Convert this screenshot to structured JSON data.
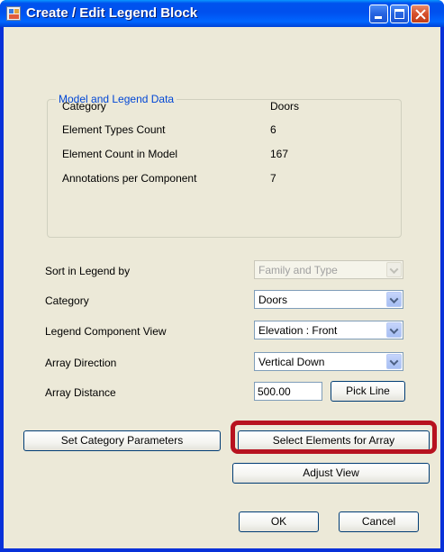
{
  "window": {
    "title": "Create / Edit Legend Block"
  },
  "group": {
    "title": "Model and Legend Data",
    "rows": [
      {
        "label": "Category",
        "value": "Doors"
      },
      {
        "label": "Element Types Count",
        "value": "6"
      },
      {
        "label": "Element Count in Model",
        "value": "167"
      },
      {
        "label": "Annotations per Component",
        "value": "7"
      }
    ]
  },
  "form": {
    "sort_label": "Sort in Legend by",
    "sort_value": "Family and Type",
    "category_label": "Category",
    "category_value": "Doors",
    "view_label": "Legend Component View",
    "view_value": "Elevation : Front",
    "direction_label": "Array Direction",
    "direction_value": "Vertical Down",
    "distance_label": "Array Distance",
    "distance_value": "500.00",
    "pick_line_label": "Pick Line"
  },
  "buttons": {
    "set_category_parameters": "Set Category Parameters",
    "select_elements": "Select Elements for Array",
    "adjust_view": "Adjust View",
    "ok": "OK",
    "cancel": "Cancel"
  },
  "colors": {
    "highlight": "#b7121f",
    "group_title": "#0046d5",
    "titlebar": "#0053ee"
  },
  "icons": [
    "app-icon",
    "minimize-icon",
    "maximize-icon",
    "close-icon",
    "chevron-down-icon"
  ]
}
